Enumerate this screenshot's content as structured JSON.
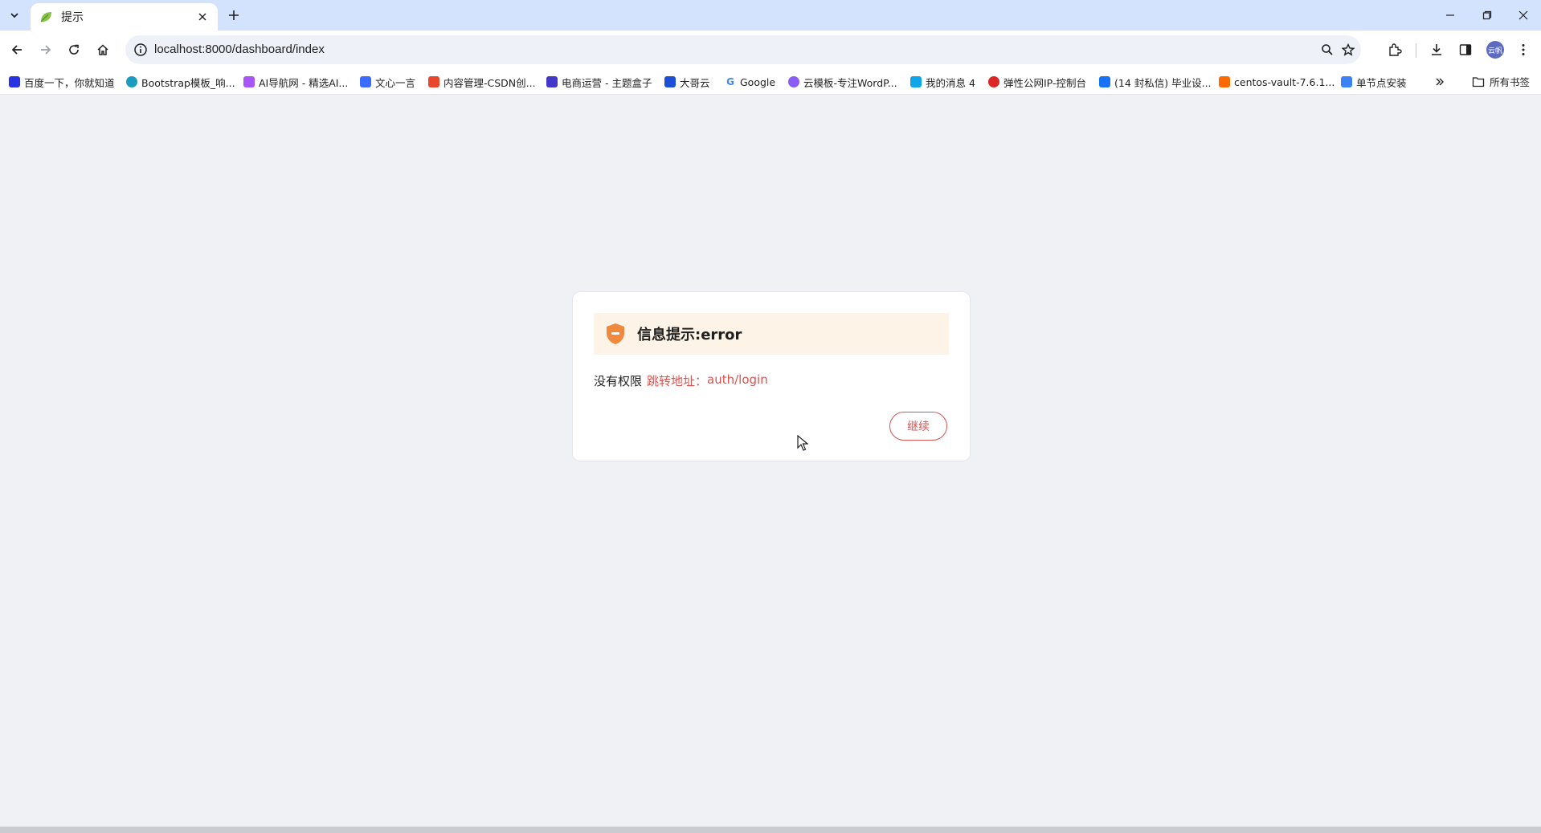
{
  "tab": {
    "title": "提示"
  },
  "address": {
    "url": "localhost:8000/dashboard/index"
  },
  "profile": {
    "initials": "云帆"
  },
  "bookmarks": [
    {
      "label": "百度一下，你就知道",
      "icon_color": "#2932e1"
    },
    {
      "label": "Bootstrap模板_响...",
      "icon_color": "#1a9bbf"
    },
    {
      "label": "AI导航网 - 精选AI...",
      "icon_color": "#a855f7"
    },
    {
      "label": "文心一言",
      "icon_color": "#3b6cff"
    },
    {
      "label": "内容管理-CSDN创...",
      "icon_color": "#e8472c"
    },
    {
      "label": "电商运营 - 主题盒子",
      "icon_color": "#4338ca"
    },
    {
      "label": "大哥云",
      "icon_color": "#1d4ed8"
    },
    {
      "label": "Google",
      "icon_color": "#ffffff"
    },
    {
      "label": "云模板-专注WordP...",
      "icon_color": "#8b5cf6"
    },
    {
      "label": "我的消息 4",
      "icon_color": "#0ea5e9"
    },
    {
      "label": "弹性公网IP-控制台",
      "icon_color": "#dc2626"
    },
    {
      "label": "(14 封私信) 毕业设...",
      "icon_color": "#1772f6"
    },
    {
      "label": "centos-vault-7.6.1...",
      "icon_color": "#ff6a00"
    },
    {
      "label": "单节点安装",
      "icon_color": "#3b82f6"
    }
  ],
  "bookmarks_folder": {
    "label": "所有书签"
  },
  "dialog": {
    "title": "信息提示:error",
    "message": "没有权限",
    "redirect_label": "跳转地址：",
    "redirect_url": "auth/login",
    "continue_label": "继续"
  },
  "colors": {
    "accent": "#d9534f",
    "header_bg": "#fdf3e6",
    "shield": "#f0883e",
    "tabstrip": "#d3e3fd"
  }
}
